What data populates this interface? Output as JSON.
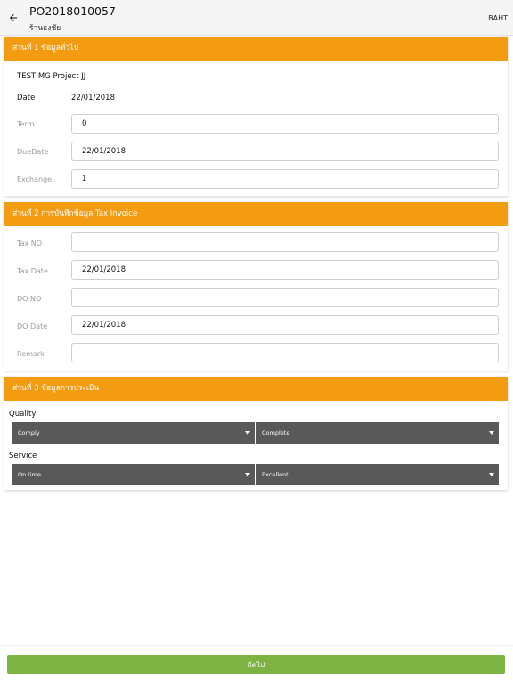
{
  "header": {
    "po_number": "PO2018010057",
    "shop_name": "ร้านธงชัย",
    "currency": "BAHT"
  },
  "section1": {
    "title": "ส่วนที่ 1   ข้อมูลทั่วไป",
    "project": "TEST MG Project JJ",
    "date_label": "Date",
    "date_value": "22/01/2018",
    "term_label": "Term",
    "term_value": "0",
    "duedate_label": "DueDate",
    "duedate_value": "22/01/2018",
    "exchange_label": "Exchange",
    "exchange_value": "1"
  },
  "section2": {
    "title": "ส่วนที่ 2   การบันทึกข้อมูล Tax Invoice",
    "taxno_label": "Tax NO",
    "taxno_value": "",
    "taxdate_label": "Tax Date",
    "taxdate_value": "22/01/2018",
    "dono_label": "DO NO",
    "dono_value": "",
    "dodate_label": "DO Date",
    "dodate_value": "22/01/2018",
    "remark_label": "Remark",
    "remark_value": ""
  },
  "section3": {
    "title": "ส่วนที่ 3   ข้อมูลการประเมิน",
    "quality_label": "Quality",
    "quality_select1": "Comply",
    "quality_select2": "Complete",
    "service_label": "Service",
    "service_select1": "On time",
    "service_select2": "Excellent"
  },
  "footer": {
    "next_label": "ถัดไป"
  },
  "colors": {
    "section_header": "#f39c12",
    "select_bg": "#595959",
    "next_button": "#7cb342"
  },
  "icons": {
    "back": "arrow-left-icon",
    "dropdown": "caret-down-icon"
  }
}
